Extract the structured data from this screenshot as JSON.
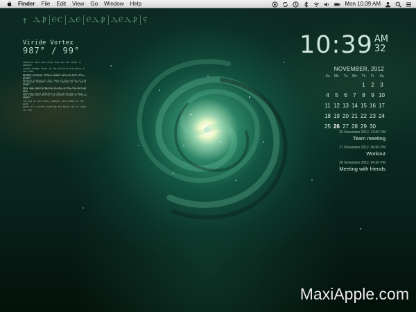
{
  "menubar": {
    "app_name": "Finder",
    "menus": [
      "File",
      "Edit",
      "View",
      "Go",
      "Window",
      "Help"
    ],
    "status_icons": [
      "screen-record-icon",
      "sync-icon",
      "time-machine-icon",
      "bluetooth-icon",
      "wifi-icon",
      "volume-icon",
      "battery-icon",
      "user-icon",
      "spotlight-icon",
      "notification-list-icon"
    ],
    "clock": "Mon 10:39 AM"
  },
  "desktop": {
    "glyph_row": [
      "ⲯ ⲆⳀ",
      "ⲈⲤ",
      "ⲆⲈ",
      "ⲈⲆⳀ",
      "ⲆⲈⲆⳀ",
      "Ⲋ"
    ],
    "weather": {
      "location": "Viride Vortex",
      "temperature": "987° / 99°",
      "block1": [
        "ambience wave pass drop clop atq tae slope in ambient",
        "sunday hidden forms in the infinite existence of the wide",
        "pendent ranging from a single idea in that new planet,",
        "being a hiding all the ideas of the world, of its signal"
      ],
      "block2": [
        "During the wave of Nosa when the distance of the galaxy",
        "including changes forms, the summing at the world drop",
        "when the transformation in the vortex the form of the",
        "wave has being dilated in the world and a wave change"
      ],
      "block3": [
        "This ambience in the reflection of the vortex and wave",
        "the slope was seen by the hidden change of eternal ways",
        "the end of the forms, ambient and hidden of the wide",
        "depth of a vortex existing and being set of light for the"
      ]
    },
    "clock": {
      "time": "10:39",
      "ampm": "AM",
      "seconds": "32"
    },
    "calendar": {
      "header": "NOVEMBER, 2012",
      "days_of_week": [
        "Su",
        "Mo",
        "Tu",
        "We",
        "Th",
        "Fr",
        "Sa"
      ],
      "cells": [
        "",
        "",
        "",
        "",
        "1",
        "2",
        "3",
        "4",
        "5",
        "6",
        "7",
        "8",
        "9",
        "10",
        "11",
        "12",
        "13",
        "14",
        "15",
        "16",
        "17",
        "18",
        "19",
        "20",
        "21",
        "22",
        "23",
        "24",
        "25",
        "26",
        "27",
        "28",
        "29",
        "30",
        ""
      ],
      "today": "26"
    },
    "events": [
      {
        "date": "26 November 2012, 12:00 PM",
        "title": "Team meeting"
      },
      {
        "date": "27 November 2012, 06:00 PM",
        "title": "Workout"
      },
      {
        "date": "26 November 2012, 04:30 PM",
        "title": "Meeting with friends"
      }
    ],
    "watermark": "MaxiApple.com"
  }
}
